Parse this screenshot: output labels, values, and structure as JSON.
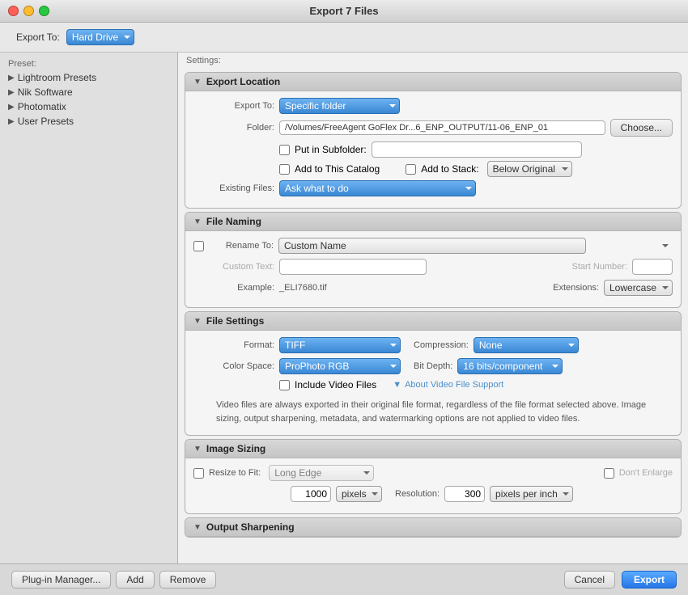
{
  "titlebar": {
    "title": "Export 7 Files"
  },
  "export_to_bar": {
    "label": "Export To:",
    "value": "Hard Drive"
  },
  "sidebar": {
    "preset_label": "Preset:",
    "items": [
      {
        "label": "Lightroom Presets",
        "id": "lightroom-presets"
      },
      {
        "label": "Nik Software",
        "id": "nik-software"
      },
      {
        "label": "Photomatix",
        "id": "photomatix"
      },
      {
        "label": "User Presets",
        "id": "user-presets"
      }
    ]
  },
  "settings": {
    "label": "Settings:",
    "sections": {
      "export_location": {
        "title": "Export Location",
        "export_to_label": "Export To:",
        "export_to_value": "Specific folder",
        "folder_label": "Folder:",
        "folder_path": "/Volumes/FreeAgent GoFlex Dr...6_ENP_OUTPUT/11-06_ENP_01",
        "choose_button": "Choose...",
        "put_in_subfolder_label": "Put in Subfolder:",
        "add_to_catalog_label": "Add to This Catalog",
        "add_to_stack_label": "Add to Stack:",
        "below_original_label": "Below Original",
        "existing_files_label": "Existing Files:",
        "existing_files_value": "Ask what to do"
      },
      "file_naming": {
        "title": "File Naming",
        "rename_to_label": "Rename To:",
        "rename_to_value": "Custom Name",
        "custom_text_label": "Custom Text:",
        "start_number_label": "Start Number:",
        "example_label": "Example:",
        "example_value": "_ELI7680.tif",
        "extensions_label": "Extensions:",
        "extensions_value": "Lowercase"
      },
      "file_settings": {
        "title": "File Settings",
        "format_label": "Format:",
        "format_value": "TIFF",
        "compression_label": "Compression:",
        "compression_value": "None",
        "color_space_label": "Color Space:",
        "color_space_value": "ProPhoto RGB",
        "bit_depth_label": "Bit Depth:",
        "bit_depth_value": "16 bits/component",
        "include_video_label": "Include Video Files",
        "about_video_label": "About Video File Support",
        "video_note": "Video files are always exported in their original file format, regardless of the file format selected above. Image sizing, output sharpening, metadata, and watermarking options are not applied to video files."
      },
      "image_sizing": {
        "title": "Image Sizing",
        "resize_to_fit_label": "Resize to Fit:",
        "resize_to_fit_value": "Long Edge",
        "dont_enlarge_label": "Don't Enlarge",
        "pixels_value": "1000",
        "pixels_unit": "pixels",
        "resolution_label": "Resolution:",
        "resolution_value": "300",
        "resolution_unit": "pixels per inch"
      },
      "output_sharpening": {
        "title": "Output Sharpening"
      }
    }
  },
  "bottom": {
    "plugin_manager": "Plug-in Manager...",
    "add_button": "Add",
    "remove_button": "Remove",
    "cancel_button": "Cancel",
    "export_button": "Export"
  }
}
